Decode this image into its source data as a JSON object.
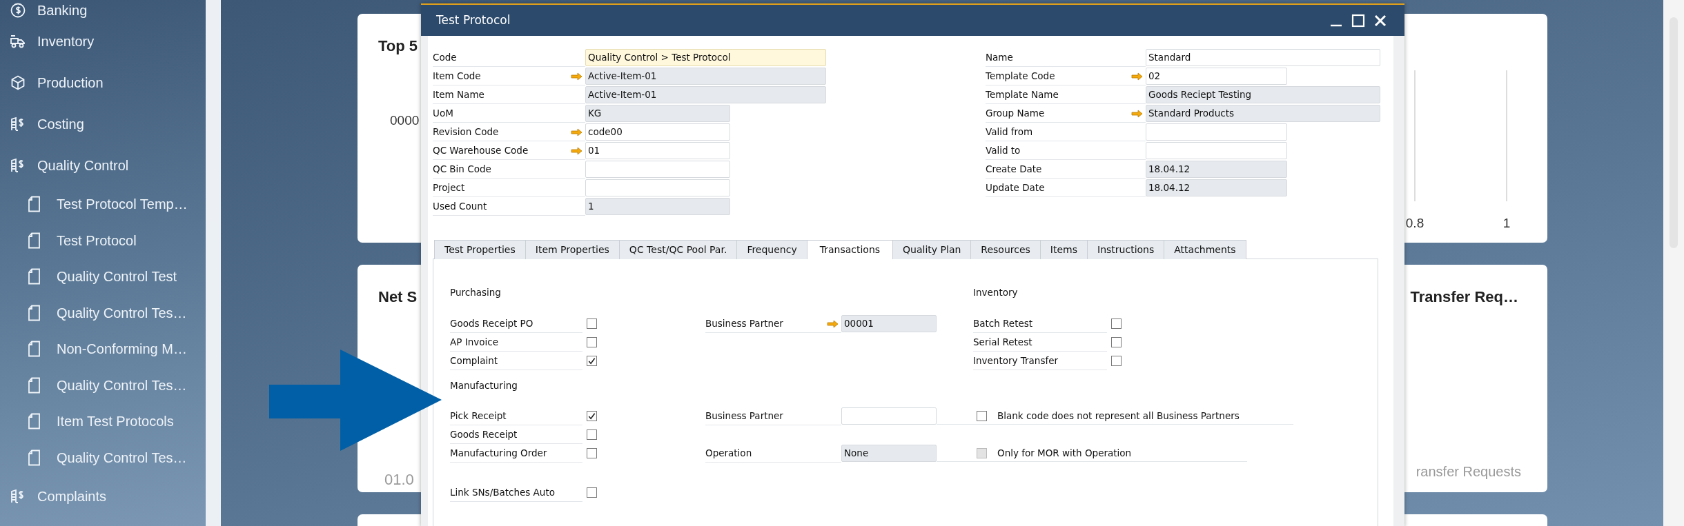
{
  "sidebar": {
    "items": [
      {
        "label": "Banking"
      },
      {
        "label": "Inventory"
      },
      {
        "label": "Production"
      },
      {
        "label": "Costing"
      },
      {
        "label": "Quality Control",
        "children": [
          {
            "label": "Test Protocol Temp…"
          },
          {
            "label": "Test Protocol"
          },
          {
            "label": "Quality Control Test"
          },
          {
            "label": "Quality Control Tes…"
          },
          {
            "label": "Non-Conforming M…"
          },
          {
            "label": "Quality Control Tes…"
          },
          {
            "label": "Item Test Protocols"
          },
          {
            "label": "Quality Control Tes…"
          }
        ]
      },
      {
        "label": "Complaints"
      }
    ]
  },
  "dashboard": {
    "left_cards": [
      {
        "title": "Top 5",
        "text": "0000"
      },
      {
        "title": "Net S",
        "text": "01.0"
      }
    ],
    "right_cards": [
      {
        "axis_labels": [
          "0.8",
          "1"
        ]
      },
      {
        "title": "Transfer Req…",
        "text": "ransfer Requests"
      }
    ]
  },
  "dialog": {
    "title": "Test Protocol",
    "left_fields": [
      {
        "label": "Code",
        "value": "Quality Control > Test Protocol",
        "kind": "focus",
        "wide": true,
        "link": false
      },
      {
        "label": "Item Code",
        "value": "Active-Item-01",
        "kind": "readonly",
        "wide": true,
        "link": true
      },
      {
        "label": "Item Name",
        "value": "Active-Item-01",
        "kind": "readonly",
        "wide": true,
        "link": false
      },
      {
        "label": "UoM",
        "value": "KG",
        "kind": "readonly",
        "wide": false,
        "link": false
      },
      {
        "label": "Revision Code",
        "value": "code00",
        "kind": "editable",
        "wide": false,
        "link": true
      },
      {
        "label": "QC Warehouse Code",
        "value": "01",
        "kind": "editable",
        "wide": false,
        "link": true
      },
      {
        "label": "QC Bin Code",
        "kind": "editable",
        "wide": false,
        "link": false
      },
      {
        "label": "Project",
        "kind": "editable",
        "wide": false,
        "link": false
      },
      {
        "label": "Used Count",
        "value": "1",
        "kind": "readonly",
        "wide": false,
        "link": false
      }
    ],
    "right_fields": [
      {
        "label": "Name",
        "value": "Standard",
        "kind": "editable",
        "wide": true,
        "link": false
      },
      {
        "label": "Template Code",
        "value": "02",
        "kind": "editable",
        "wide": false,
        "link": true
      },
      {
        "label": "Template Name",
        "value": "Goods Reciept Testing",
        "kind": "readonly",
        "wide": true,
        "link": false
      },
      {
        "label": "Group Name",
        "value": "Standard Products",
        "kind": "readonly",
        "wide": true,
        "link": true
      },
      {
        "label": "Valid from",
        "kind": "editable",
        "wide": false,
        "link": false
      },
      {
        "label": "Valid to",
        "kind": "editable",
        "wide": false,
        "link": false
      },
      {
        "label": "Create Date",
        "value": "18.04.12",
        "kind": "readonly",
        "wide": false,
        "link": false
      },
      {
        "label": "Update Date",
        "value": "18.04.12",
        "kind": "readonly",
        "wide": false,
        "link": false
      }
    ],
    "tabs": [
      {
        "label": "Test Properties",
        "selected": false
      },
      {
        "label": "Item Properties",
        "selected": false
      },
      {
        "label": "QC Test/QC Pool Par.",
        "selected": false
      },
      {
        "label": "Frequency",
        "selected": false
      },
      {
        "label": "Transactions",
        "selected": true
      },
      {
        "label": "Quality Plan",
        "selected": false
      },
      {
        "label": "Resources",
        "selected": false
      },
      {
        "label": "Items",
        "selected": false
      },
      {
        "label": "Instructions",
        "selected": false
      },
      {
        "label": "Attachments",
        "selected": false
      }
    ],
    "transactions": {
      "purchasing": {
        "heading": "Purchasing",
        "checks": [
          {
            "label": "Goods Receipt PO",
            "checked": false
          },
          {
            "label": "AP Invoice",
            "checked": false
          },
          {
            "label": "Complaint",
            "checked": true
          }
        ],
        "partner": {
          "label": "Business Partner",
          "value": "00001",
          "kind": "readonly",
          "link": true
        }
      },
      "inventory": {
        "heading": "Inventory",
        "checks": [
          {
            "label": "Batch Retest",
            "checked": false
          },
          {
            "label": "Serial Retest",
            "checked": false
          },
          {
            "label": "Inventory Transfer",
            "checked": false
          }
        ]
      },
      "manufacturing": {
        "heading": "Manufacturing",
        "checks": [
          {
            "label": "Pick Receipt",
            "checked": true
          },
          {
            "label": "Goods Receipt",
            "checked": false
          },
          {
            "label": "Manufacturing Order",
            "checked": false
          }
        ],
        "partner": {
          "label": "Business Partner",
          "kind": "editable",
          "link": false
        },
        "partner_option": {
          "label": "Blank code does not represent all Business Partners",
          "checked": false,
          "disabled": false
        },
        "operation": {
          "label": "Operation",
          "value": "None",
          "kind": "readonly",
          "link": false
        },
        "operation_option": {
          "label": "Only for MOR with Operation",
          "checked": false,
          "disabled": true
        }
      },
      "link_option": {
        "label": "Link SNs/Batches Auto",
        "checked": false
      }
    }
  }
}
